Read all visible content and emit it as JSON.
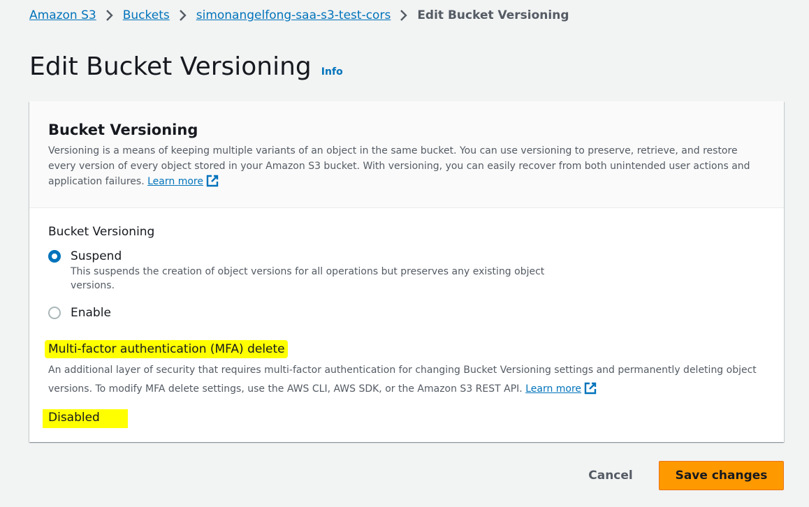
{
  "breadcrumb": {
    "items": [
      "Amazon S3",
      "Buckets",
      "simonangelfong-saa-s3-test-cors"
    ],
    "current": "Edit Bucket Versioning"
  },
  "page": {
    "title": "Edit Bucket Versioning",
    "info_label": "Info"
  },
  "versioning": {
    "title": "Bucket Versioning",
    "description": "Versioning is a means of keeping multiple variants of an object in the same bucket. You can use versioning to preserve, retrieve, and restore every version of every object stored in your Amazon S3 bucket. With versioning, you can easily recover from both unintended user actions and application failures.",
    "learn_more": "Learn more",
    "field_label": "Bucket Versioning",
    "options": [
      {
        "label": "Suspend",
        "description": "This suspends the creation of object versions for all operations but preserves any existing object versions.",
        "selected": true
      },
      {
        "label": "Enable",
        "description": "",
        "selected": false
      }
    ]
  },
  "mfa": {
    "title": "Multi-factor authentication (MFA) delete",
    "description": "An additional layer of security that requires multi-factor authentication for changing Bucket Versioning settings and permanently deleting object versions. To modify MFA delete settings, use the AWS CLI, AWS SDK, or the Amazon S3 REST API.",
    "learn_more": "Learn more",
    "status": "Disabled"
  },
  "actions": {
    "cancel": "Cancel",
    "save": "Save changes"
  },
  "colors": {
    "link": "#0073bb",
    "primary_button": "#ff9900",
    "highlight": "#ffff00",
    "background": "#f2f3f3"
  },
  "icons": {
    "breadcrumb_separator": "chevron-right-icon",
    "external_link": "external-link-icon",
    "radio_selected": "radio-checked-icon",
    "radio_unselected": "radio-unchecked-icon"
  }
}
